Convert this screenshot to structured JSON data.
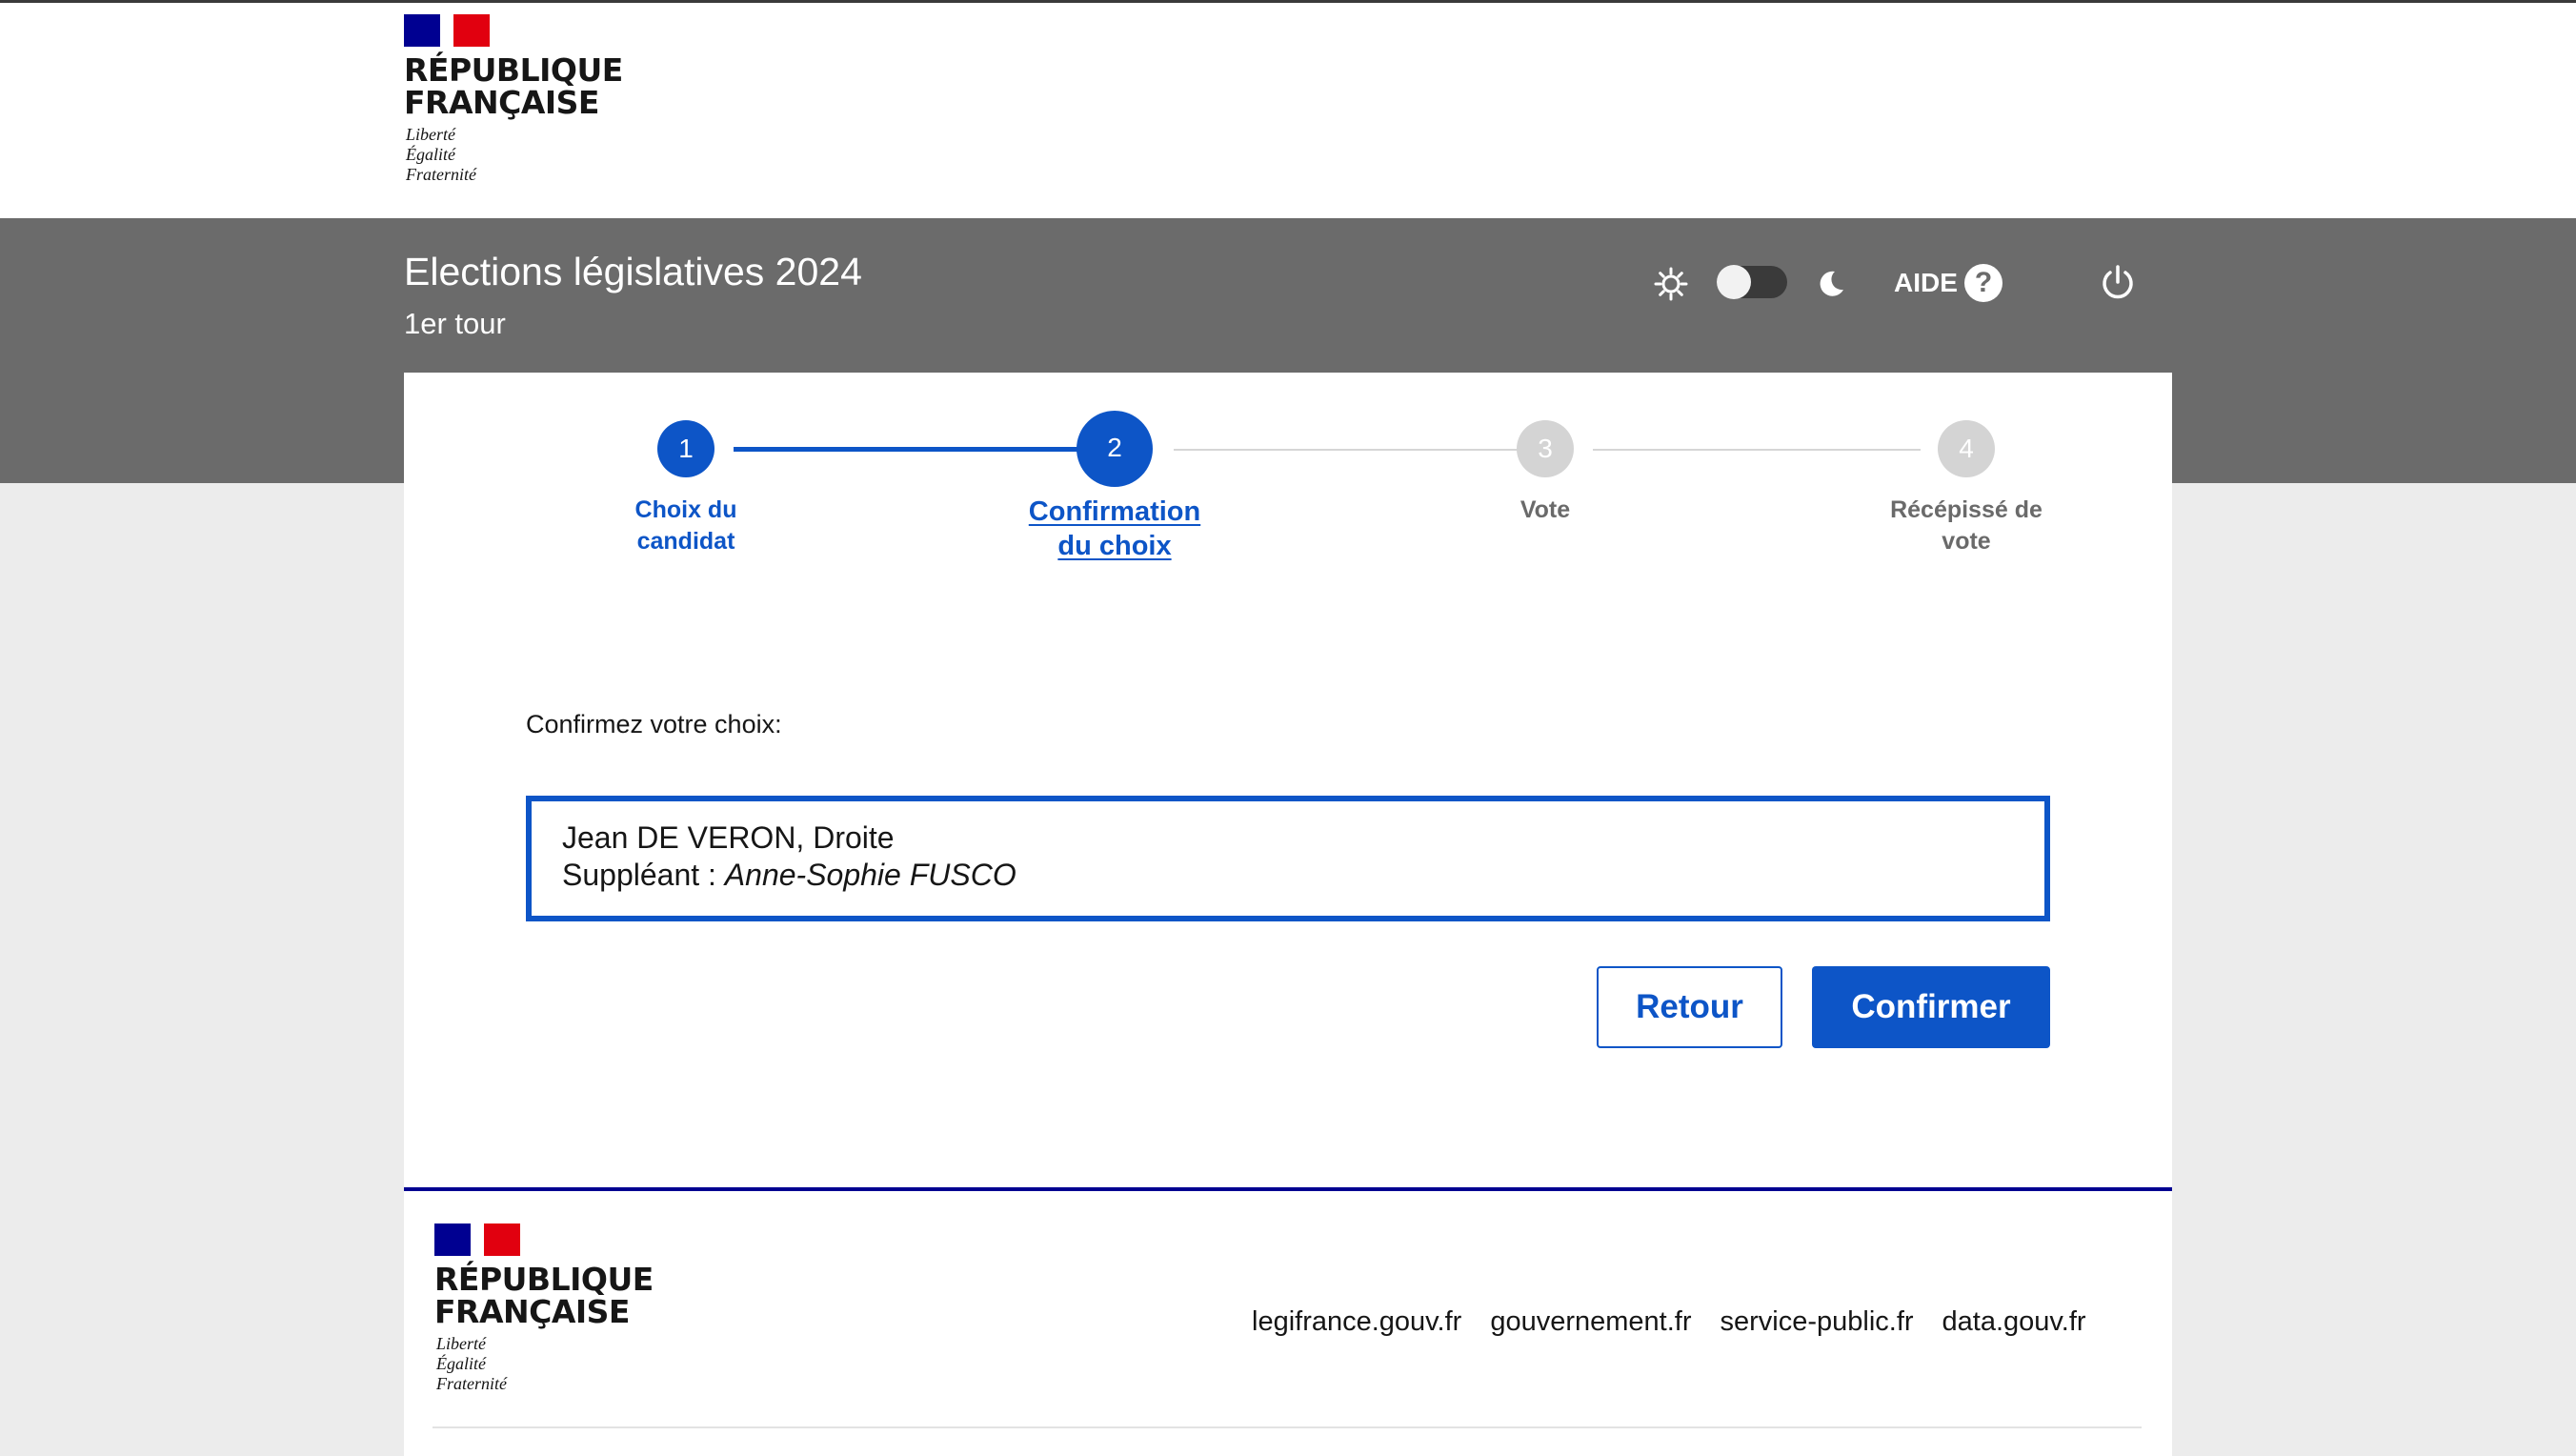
{
  "brand": {
    "name_line1": "RÉPUBLIQUE",
    "name_line2": "FRANÇAISE",
    "motto_line1": "Liberté",
    "motto_line2": "Égalité",
    "motto_line3": "Fraternité",
    "flag_colors": [
      "#000091",
      "#ffffff",
      "#e1000f"
    ]
  },
  "header": {
    "title": "Elections législatives 2024",
    "subtitle": "1er tour",
    "aide_label": "AIDE",
    "help_symbol": "?",
    "icons": [
      "sun-icon",
      "theme-toggle",
      "moon-icon",
      "help-icon",
      "power-icon"
    ]
  },
  "stepper": {
    "steps": [
      {
        "number": "1",
        "label_line1": "Choix du",
        "label_line2": "candidat",
        "state": "completed"
      },
      {
        "number": "2",
        "label_line1": "Confirmation",
        "label_line2": "du choix",
        "state": "current"
      },
      {
        "number": "3",
        "label_line1": "Vote",
        "label_line2": "",
        "state": "upcoming"
      },
      {
        "number": "4",
        "label_line1": "Récépissé de",
        "label_line2": "vote",
        "state": "upcoming"
      }
    ]
  },
  "confirmation": {
    "prompt": "Confirmez votre choix:",
    "candidate": "Jean DE VERON, Droite",
    "substitute_label": "Suppléant : ",
    "substitute_name": "Anne-Sophie FUSCO"
  },
  "actions": {
    "back_label": "Retour",
    "confirm_label": "Confirmer"
  },
  "footer": {
    "links": [
      "legifrance.gouv.fr",
      "gouvernement.fr",
      "service-public.fr",
      "data.gouv.fr"
    ]
  },
  "colors": {
    "primary": "#0d55c7",
    "header_band": "#6b6b6b",
    "page_background": "#ececec",
    "footer_rule": "#000091"
  }
}
